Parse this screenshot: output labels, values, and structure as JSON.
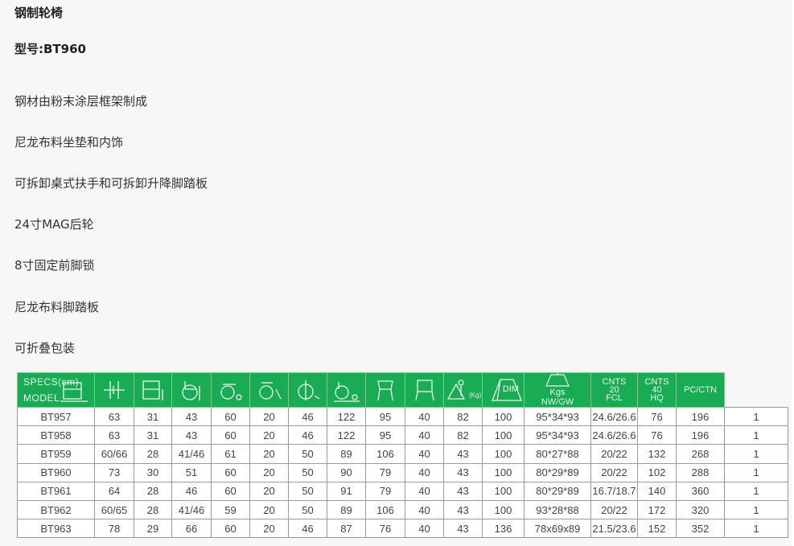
{
  "page": {
    "title": "钢制轮椅",
    "model": "型号:BT960",
    "features": [
      "钢材由粉末涂层框架制成",
      "尼龙布料坐垫和内饰",
      "可拆卸桌式扶手和可拆卸升降脚踏板",
      "24寸MAG后轮",
      "8寸固定前脚锁",
      "尼龙布料脚踏板",
      "可折叠包装"
    ]
  },
  "table": {
    "specs_label": "SPECS(cm)",
    "model_label": "MODEL",
    "dim_label": "DIM",
    "kgs_label": "Kgs",
    "nwgw_label": "NW/GW",
    "cnts20": [
      "CNTS",
      "20",
      "FCL"
    ],
    "cnts40": [
      "CNTS",
      "40",
      "HQ"
    ],
    "pcctn_label": "PC/CTN",
    "weight_unit": "(Kg)",
    "icon_names": [
      "overall-width-icon",
      "seat-width-icon",
      "seat-height-icon",
      "rear-wheel-icon",
      "caster-wheel-icon",
      "footrest-icon",
      "wheel-diameter-icon",
      "length-icon",
      "seat-depth-icon",
      "armrest-height-icon",
      "max-load-icon",
      "carton-icon"
    ],
    "header_color": "#1aab55",
    "rows": [
      [
        "BT957",
        "63",
        "31",
        "43",
        "60",
        "20",
        "46",
        "122",
        "95",
        "40",
        "82",
        "100",
        "95*34*93",
        "24.6/26.6",
        "76",
        "196",
        "1"
      ],
      [
        "BT958",
        "63",
        "31",
        "43",
        "60",
        "20",
        "46",
        "122",
        "95",
        "40",
        "82",
        "100",
        "95*34*93",
        "24.6/26.6",
        "76",
        "196",
        "1"
      ],
      [
        "BT959",
        "60/66",
        "28",
        "41/46",
        "61",
        "20",
        "50",
        "89",
        "106",
        "40",
        "43",
        "100",
        "80*27*88",
        "20/22",
        "132",
        "268",
        "1"
      ],
      [
        "BT960",
        "73",
        "30",
        "51",
        "60",
        "20",
        "50",
        "90",
        "79",
        "40",
        "43",
        "100",
        "80*29*89",
        "20/22",
        "102",
        "288",
        "1"
      ],
      [
        "BT961",
        "64",
        "28",
        "46",
        "60",
        "20",
        "50",
        "91",
        "79",
        "40",
        "43",
        "100",
        "80*29*89",
        "16.7/18.7",
        "140",
        "360",
        "1"
      ],
      [
        "BT962",
        "60/65",
        "28",
        "41/46",
        "59",
        "20",
        "50",
        "89",
        "106",
        "40",
        "43",
        "100",
        "93*28*88",
        "20/22",
        "172",
        "320",
        "1"
      ],
      [
        "BT963",
        "78",
        "29",
        "66",
        "60",
        "20",
        "46",
        "87",
        "76",
        "40",
        "43",
        "136",
        "78x69x89",
        "21.5/23.6",
        "152",
        "352",
        "1"
      ]
    ]
  }
}
